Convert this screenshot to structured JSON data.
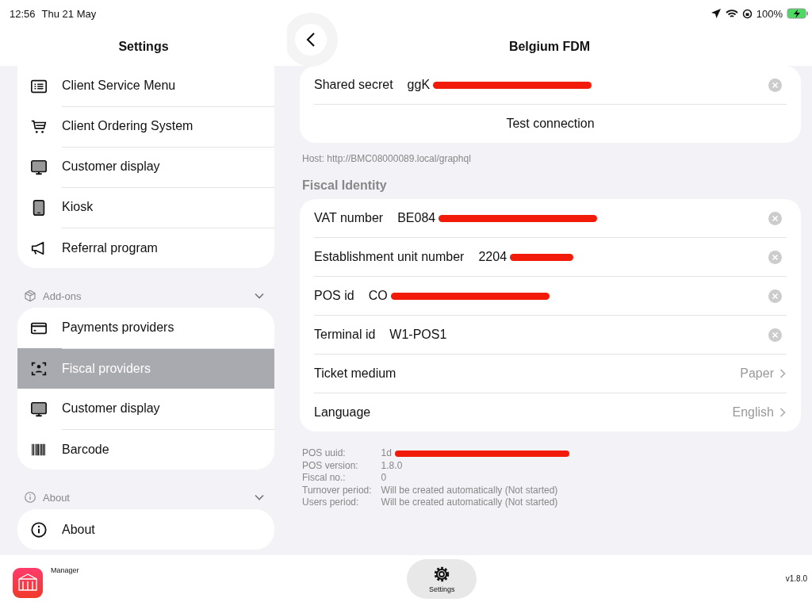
{
  "status_bar": {
    "time": "12:56",
    "date": "Thu 21 May",
    "battery": "100%"
  },
  "sidebar": {
    "title": "Settings",
    "sections": [
      {
        "items": [
          {
            "label": "Client Service Menu",
            "selected": false
          },
          {
            "label": "Client Ordering System",
            "selected": false
          },
          {
            "label": "Customer display",
            "selected": false
          },
          {
            "label": "Kiosk",
            "selected": false
          },
          {
            "label": "Referral program",
            "selected": false
          }
        ]
      },
      {
        "header": "Add-ons",
        "expanded": true,
        "items": [
          {
            "label": "Payments providers",
            "selected": false
          },
          {
            "label": "Fiscal providers",
            "selected": true
          },
          {
            "label": "Customer display",
            "selected": false
          },
          {
            "label": "Barcode",
            "selected": false
          }
        ]
      },
      {
        "header": "About",
        "expanded": true,
        "items": [
          {
            "label": "About",
            "selected": false
          }
        ]
      }
    ]
  },
  "detail": {
    "title": "Belgium FDM",
    "connection_rows": [
      {
        "kind": "field",
        "label": "Shared secret",
        "value": "ggK",
        "redacted": true
      },
      {
        "kind": "action",
        "label": "Test connection"
      }
    ],
    "host_note": "Host: http://BMC08000089.local/graphql",
    "section_title": "Fiscal Identity",
    "identity_rows": [
      {
        "kind": "field",
        "label": "VAT number",
        "value": "BE084",
        "redacted": true
      },
      {
        "kind": "field",
        "label": "Establishment unit number",
        "value": "2204",
        "redacted": true
      },
      {
        "kind": "field",
        "label": "POS id",
        "value": "CO",
        "redacted": true
      },
      {
        "kind": "field",
        "label": "Terminal id",
        "value": "W1-POS1",
        "redacted": false
      },
      {
        "kind": "select",
        "label": "Ticket medium",
        "value": "Paper"
      },
      {
        "kind": "select",
        "label": "Language",
        "value": "English"
      }
    ],
    "info": [
      {
        "label": "POS uuid:",
        "value": "1d",
        "redacted": true
      },
      {
        "label": "POS version:",
        "value": "1.8.0",
        "redacted": false
      },
      {
        "label": "Fiscal no.:",
        "value": "0",
        "redacted": false
      },
      {
        "label": "Turnover period:",
        "value": "Will be created automatically (Not started)",
        "redacted": false
      },
      {
        "label": "Users period:",
        "value": "Will be created automatically (Not started)",
        "redacted": false
      }
    ]
  },
  "bottom_bar": {
    "app_name": "Manager",
    "tab": {
      "label": "Settings",
      "selected": true
    },
    "version": "v1.8.0"
  }
}
